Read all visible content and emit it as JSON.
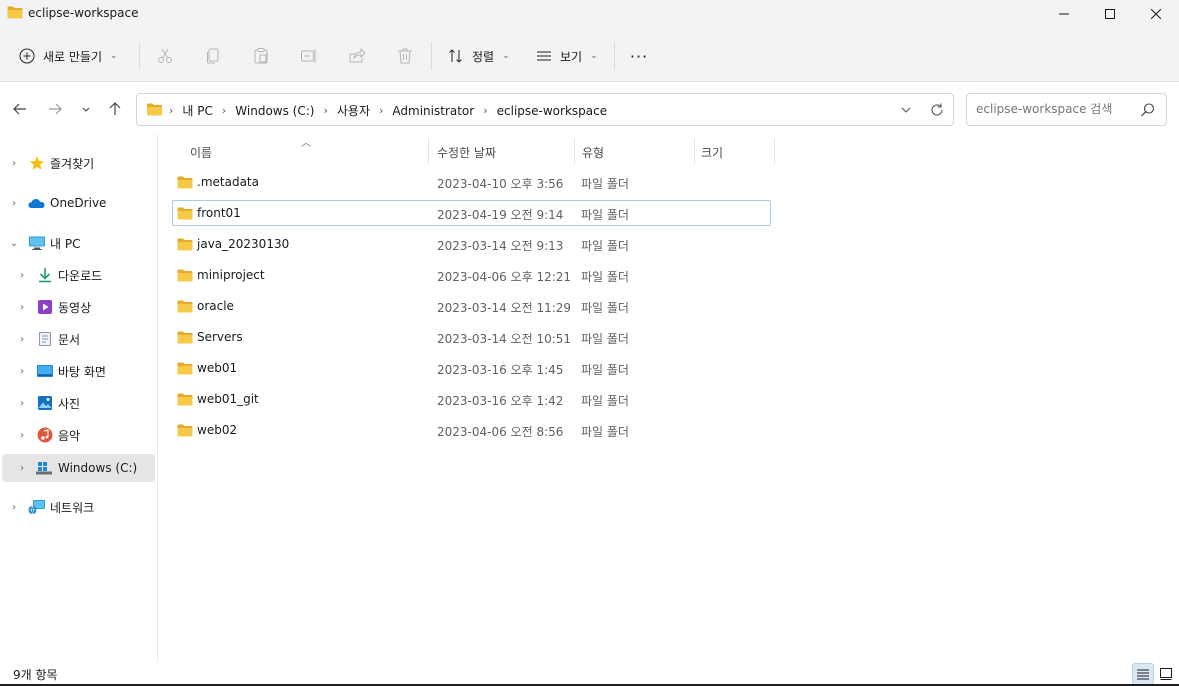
{
  "window": {
    "title": "eclipse-workspace"
  },
  "toolbar": {
    "new_label": "새로 만들기",
    "sort_label": "정렬",
    "view_label": "보기",
    "more_label": "···"
  },
  "address": {
    "crumbs": [
      "내 PC",
      "Windows (C:)",
      "사용자",
      "Administrator",
      "eclipse-workspace"
    ]
  },
  "search": {
    "placeholder": "eclipse-workspace 검색"
  },
  "sidebar": {
    "items": [
      {
        "label": "즐겨찾기",
        "icon": "star-icon"
      },
      {
        "label": "OneDrive",
        "icon": "cloud-icon"
      },
      {
        "label": "내 PC",
        "icon": "pc-icon"
      },
      {
        "label": "다운로드",
        "icon": "download-icon"
      },
      {
        "label": "동영상",
        "icon": "video-icon"
      },
      {
        "label": "문서",
        "icon": "document-icon"
      },
      {
        "label": "바탕 화면",
        "icon": "desktop-icon"
      },
      {
        "label": "사진",
        "icon": "picture-icon"
      },
      {
        "label": "음악",
        "icon": "music-icon"
      },
      {
        "label": "Windows (C:)",
        "icon": "drive-icon"
      },
      {
        "label": "네트워크",
        "icon": "network-icon"
      }
    ]
  },
  "columns": {
    "name": "이름",
    "date": "수정한 날짜",
    "type": "유형",
    "size": "크기"
  },
  "files": [
    {
      "name": ".metadata",
      "date": "2023-04-10 오후 3:56",
      "type": "파일 폴더"
    },
    {
      "name": "front01",
      "date": "2023-04-19 오전 9:14",
      "type": "파일 폴더"
    },
    {
      "name": "java_20230130",
      "date": "2023-03-14 오전 9:13",
      "type": "파일 폴더"
    },
    {
      "name": "miniproject",
      "date": "2023-04-06 오후 12:21",
      "type": "파일 폴더"
    },
    {
      "name": "oracle",
      "date": "2023-03-14 오전 11:29",
      "type": "파일 폴더"
    },
    {
      "name": "Servers",
      "date": "2023-03-14 오전 10:51",
      "type": "파일 폴더"
    },
    {
      "name": "web01",
      "date": "2023-03-16 오후 1:45",
      "type": "파일 폴더"
    },
    {
      "name": "web01_git",
      "date": "2023-03-16 오후 1:42",
      "type": "파일 폴더"
    },
    {
      "name": "web02",
      "date": "2023-04-06 오전 8:56",
      "type": "파일 폴더"
    }
  ],
  "status": {
    "item_count": "9개 항목"
  },
  "colors": {
    "folder": "#f2c14e",
    "accent": "#0067c0",
    "selection": "#e5e5e5"
  }
}
